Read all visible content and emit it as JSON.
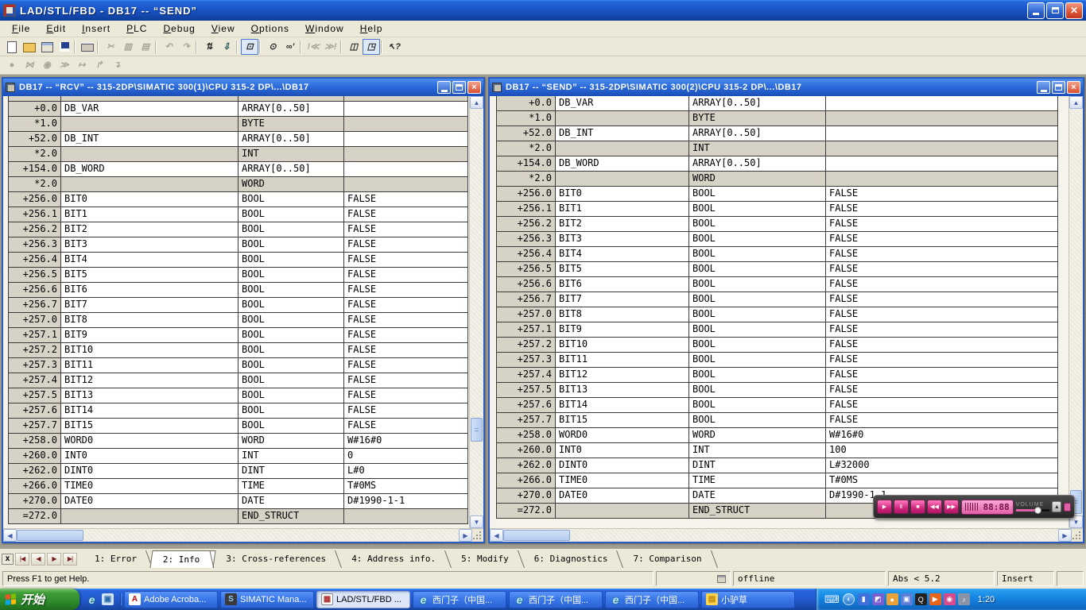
{
  "app": {
    "title": "LAD/STL/FBD  - DB17 -- “SEND”"
  },
  "menu": {
    "items": [
      {
        "label": "File"
      },
      {
        "label": "Edit"
      },
      {
        "label": "Insert"
      },
      {
        "label": "PLC"
      },
      {
        "label": "Debug"
      },
      {
        "label": "View"
      },
      {
        "label": "Options"
      },
      {
        "label": "Window"
      },
      {
        "label": "Help"
      }
    ]
  },
  "toolbar": {
    "row1": [
      {
        "name": "new-icon",
        "cls": "i-page"
      },
      {
        "name": "open-icon",
        "cls": "i-folder"
      },
      {
        "name": "station-icon",
        "cls": "i-station"
      },
      {
        "name": "save-icon",
        "cls": "i-floppy"
      },
      {
        "name": "toolbar-separator",
        "cls": "sep"
      },
      {
        "name": "print-icon",
        "cls": "i-printer"
      },
      {
        "name": "toolbar-separator",
        "cls": "sep"
      },
      {
        "name": "cut-icon",
        "glyph": "✂",
        "disabled": true
      },
      {
        "name": "copy-icon",
        "glyph": "▥",
        "disabled": true
      },
      {
        "name": "paste-icon",
        "glyph": "▤",
        "disabled": true
      },
      {
        "name": "toolbar-separator",
        "cls": "sep"
      },
      {
        "name": "undo-icon",
        "glyph": "↶",
        "disabled": true
      },
      {
        "name": "redo-icon",
        "glyph": "↷",
        "disabled": true
      },
      {
        "name": "toolbar-separator",
        "cls": "sep"
      },
      {
        "name": "call-structure-icon",
        "glyph": "⇅"
      },
      {
        "name": "download-icon",
        "glyph": "⇩",
        "cls": "dark"
      },
      {
        "name": "toolbar-separator",
        "cls": "sep"
      },
      {
        "name": "monitor-icon",
        "glyph": "⊡",
        "pressed": true
      },
      {
        "name": "toolbar-separator",
        "cls": "sep"
      },
      {
        "name": "address-icon",
        "glyph": "⊙"
      },
      {
        "name": "glasses-icon",
        "glyph": "∞'"
      },
      {
        "name": "toolbar-separator",
        "cls": "sep"
      },
      {
        "name": "prev-error-icon",
        "glyph": "!≪",
        "disabled": true
      },
      {
        "name": "next-error-icon",
        "glyph": "≫!",
        "disabled": true
      },
      {
        "name": "toolbar-separator",
        "cls": "sep"
      },
      {
        "name": "split-window-icon",
        "glyph": "◫"
      },
      {
        "name": "preview-icon",
        "glyph": "◳",
        "pressed": true
      },
      {
        "name": "toolbar-separator",
        "cls": "sep"
      },
      {
        "name": "context-help-icon",
        "glyph": "↖?"
      }
    ],
    "row2": [
      {
        "name": "new-network-icon",
        "glyph": "●",
        "disabled": true
      },
      {
        "name": "parallel-branch-icon",
        "glyph": "⋈",
        "disabled": true
      },
      {
        "name": "open-branch-icon",
        "glyph": "◉",
        "disabled": true
      },
      {
        "name": "close-branch-icon",
        "glyph": "≫",
        "disabled": true
      },
      {
        "name": "coil-icon",
        "glyph": "↦",
        "disabled": true
      },
      {
        "name": "jump-icon",
        "glyph": "↱",
        "disabled": true
      },
      {
        "name": "insert-row-icon",
        "glyph": "↴",
        "disabled": true
      }
    ]
  },
  "windows": {
    "left": {
      "title": "DB17 -- “RCV” -- 315-2DP\\SIMATIC 300(1)\\CPU 315-2 DP\\...\\DB17",
      "rows": [
        {
          "addr": "+0.0",
          "name": "DB_VAR",
          "type": "ARRAY[0..50]",
          "init": ""
        },
        {
          "addr": "*1.0",
          "name": "",
          "type": "BYTE",
          "init": "",
          "cls": "gray"
        },
        {
          "addr": "+52.0",
          "name": "DB_INT",
          "type": "ARRAY[0..50]",
          "init": ""
        },
        {
          "addr": "*2.0",
          "name": "",
          "type": "INT",
          "init": "",
          "cls": "gray"
        },
        {
          "addr": "+154.0",
          "name": "DB_WORD",
          "type": "ARRAY[0..50]",
          "init": ""
        },
        {
          "addr": "*2.0",
          "name": "",
          "type": "WORD",
          "init": "",
          "cls": "gray"
        },
        {
          "addr": "+256.0",
          "name": "BIT0",
          "type": "BOOL",
          "init": "FALSE"
        },
        {
          "addr": "+256.1",
          "name": "BIT1",
          "type": "BOOL",
          "init": "FALSE"
        },
        {
          "addr": "+256.2",
          "name": "BIT2",
          "type": "BOOL",
          "init": "FALSE"
        },
        {
          "addr": "+256.3",
          "name": "BIT3",
          "type": "BOOL",
          "init": "FALSE"
        },
        {
          "addr": "+256.4",
          "name": "BIT4",
          "type": "BOOL",
          "init": "FALSE"
        },
        {
          "addr": "+256.5",
          "name": "BIT5",
          "type": "BOOL",
          "init": "FALSE"
        },
        {
          "addr": "+256.6",
          "name": "BIT6",
          "type": "BOOL",
          "init": "FALSE"
        },
        {
          "addr": "+256.7",
          "name": "BIT7",
          "type": "BOOL",
          "init": "FALSE"
        },
        {
          "addr": "+257.0",
          "name": "BIT8",
          "type": "BOOL",
          "init": "FALSE"
        },
        {
          "addr": "+257.1",
          "name": "BIT9",
          "type": "BOOL",
          "init": "FALSE"
        },
        {
          "addr": "+257.2",
          "name": "BIT10",
          "type": "BOOL",
          "init": "FALSE"
        },
        {
          "addr": "+257.3",
          "name": "BIT11",
          "type": "BOOL",
          "init": "FALSE"
        },
        {
          "addr": "+257.4",
          "name": "BIT12",
          "type": "BOOL",
          "init": "FALSE"
        },
        {
          "addr": "+257.5",
          "name": "BIT13",
          "type": "BOOL",
          "init": "FALSE"
        },
        {
          "addr": "+257.6",
          "name": "BIT14",
          "type": "BOOL",
          "init": "FALSE"
        },
        {
          "addr": "+257.7",
          "name": "BIT15",
          "type": "BOOL",
          "init": "FALSE"
        },
        {
          "addr": "+258.0",
          "name": "WORD0",
          "type": "WORD",
          "init": "W#16#0"
        },
        {
          "addr": "+260.0",
          "name": "INT0",
          "type": "INT",
          "init": "0"
        },
        {
          "addr": "+262.0",
          "name": "DINT0",
          "type": "DINT",
          "init": "L#0"
        },
        {
          "addr": "+266.0",
          "name": "TIME0",
          "type": "TIME",
          "init": "T#0MS"
        },
        {
          "addr": "+270.0",
          "name": "DATE0",
          "type": "DATE",
          "init": "D#1990-1-1"
        },
        {
          "addr": "=272.0",
          "name": "",
          "type": "END_STRUCT",
          "init": "",
          "cls": "gray"
        }
      ]
    },
    "right": {
      "title": "DB17 -- “SEND” -- 315-2DP\\SIMATIC 300(2)\\CPU 315-2 DP\\...\\DB17",
      "rows": [
        {
          "addr": "+0.0",
          "name": "DB_VAR",
          "type": "ARRAY[0..50]",
          "init": ""
        },
        {
          "addr": "*1.0",
          "name": "",
          "type": "BYTE",
          "init": "",
          "cls": "gray"
        },
        {
          "addr": "+52.0",
          "name": "DB_INT",
          "type": "ARRAY[0..50]",
          "init": ""
        },
        {
          "addr": "*2.0",
          "name": "",
          "type": "INT",
          "init": "",
          "cls": "gray"
        },
        {
          "addr": "+154.0",
          "name": "DB_WORD",
          "type": "ARRAY[0..50]",
          "init": ""
        },
        {
          "addr": "*2.0",
          "name": "",
          "type": "WORD",
          "init": "",
          "cls": "gray"
        },
        {
          "addr": "+256.0",
          "name": "BIT0",
          "type": "BOOL",
          "init": "FALSE"
        },
        {
          "addr": "+256.1",
          "name": "BIT1",
          "type": "BOOL",
          "init": "FALSE"
        },
        {
          "addr": "+256.2",
          "name": "BIT2",
          "type": "BOOL",
          "init": "FALSE"
        },
        {
          "addr": "+256.3",
          "name": "BIT3",
          "type": "BOOL",
          "init": "FALSE"
        },
        {
          "addr": "+256.4",
          "name": "BIT4",
          "type": "BOOL",
          "init": "FALSE"
        },
        {
          "addr": "+256.5",
          "name": "BIT5",
          "type": "BOOL",
          "init": "FALSE"
        },
        {
          "addr": "+256.6",
          "name": "BIT6",
          "type": "BOOL",
          "init": "FALSE"
        },
        {
          "addr": "+256.7",
          "name": "BIT7",
          "type": "BOOL",
          "init": "FALSE"
        },
        {
          "addr": "+257.0",
          "name": "BIT8",
          "type": "BOOL",
          "init": "FALSE"
        },
        {
          "addr": "+257.1",
          "name": "BIT9",
          "type": "BOOL",
          "init": "FALSE"
        },
        {
          "addr": "+257.2",
          "name": "BIT10",
          "type": "BOOL",
          "init": "FALSE"
        },
        {
          "addr": "+257.3",
          "name": "BIT11",
          "type": "BOOL",
          "init": "FALSE"
        },
        {
          "addr": "+257.4",
          "name": "BIT12",
          "type": "BOOL",
          "init": "FALSE"
        },
        {
          "addr": "+257.5",
          "name": "BIT13",
          "type": "BOOL",
          "init": "FALSE"
        },
        {
          "addr": "+257.6",
          "name": "BIT14",
          "type": "BOOL",
          "init": "FALSE"
        },
        {
          "addr": "+257.7",
          "name": "BIT15",
          "type": "BOOL",
          "init": "FALSE"
        },
        {
          "addr": "+258.0",
          "name": "WORD0",
          "type": "WORD",
          "init": "W#16#0"
        },
        {
          "addr": "+260.0",
          "name": "INT0",
          "type": "INT",
          "init": "100"
        },
        {
          "addr": "+262.0",
          "name": "DINT0",
          "type": "DINT",
          "init": "L#32000"
        },
        {
          "addr": "+266.0",
          "name": "TIME0",
          "type": "TIME",
          "init": "T#0MS"
        },
        {
          "addr": "+270.0",
          "name": "DATE0",
          "type": "DATE",
          "init": "D#1990-1-1"
        },
        {
          "addr": "=272.0",
          "name": "",
          "type": "END_STRUCT",
          "init": "",
          "cls": "gray"
        }
      ]
    }
  },
  "tabs": {
    "items": [
      {
        "label": "1: Error"
      },
      {
        "label": "2: Info",
        "active": true
      },
      {
        "label": "3: Cross-references"
      },
      {
        "label": "4: Address info."
      },
      {
        "label": "5: Modify"
      },
      {
        "label": "6: Diagnostics"
      },
      {
        "label": "7: Comparison"
      }
    ]
  },
  "statusbar": {
    "help": "Press F1 to get Help.",
    "mode": "offline",
    "abs": "Abs < 5.2",
    "insert": "Insert"
  },
  "player": {
    "volume_label": "VOLUME",
    "time": "88:88",
    "buttons": [
      {
        "name": "play-button",
        "glyph": "▶"
      },
      {
        "name": "pause-button",
        "glyph": "Ⅱ"
      },
      {
        "name": "stop-button",
        "glyph": "■"
      },
      {
        "name": "prev-button",
        "glyph": "◀◀"
      },
      {
        "name": "next-button",
        "glyph": "▶▶"
      }
    ]
  },
  "taskbar": {
    "start_label": "开始",
    "quick": [
      {
        "name": "quicklaunch-ie",
        "icon": "ie"
      },
      {
        "name": "quicklaunch-desktop",
        "icon": "desk"
      }
    ],
    "buttons": [
      {
        "icon": "adobe",
        "label": "Adobe Acroba..."
      },
      {
        "icon": "simatic",
        "label": "SIMATIC Mana..."
      },
      {
        "icon": "lad",
        "label": "LAD/STL/FBD ...",
        "active": true
      },
      {
        "icon": "ie",
        "label": "西门子（中国..."
      },
      {
        "icon": "ie",
        "label": "西门子（中国..."
      },
      {
        "icon": "ie",
        "label": "西门子（中国..."
      },
      {
        "icon": "note",
        "label": "小驴草"
      }
    ],
    "tray": {
      "keyboard": "⌨",
      "chevron": "‹",
      "icons": [
        {
          "name": "battery-icon",
          "glyph": "▮",
          "color": "#3f6fd8"
        },
        {
          "name": "device-icon",
          "glyph": "◩",
          "color": "#7a5fd0"
        },
        {
          "name": "pplive-icon",
          "glyph": "●",
          "color": "#e8a23a"
        },
        {
          "name": "display-icon",
          "glyph": "▣",
          "color": "#5a7fd8"
        },
        {
          "name": "qq-icon",
          "glyph": "Q",
          "color": "#222222"
        },
        {
          "name": "media-play-icon",
          "glyph": "▶",
          "color": "#e8641a"
        },
        {
          "name": "camera-icon",
          "glyph": "◉",
          "color": "#d84a8a"
        },
        {
          "name": "volume-icon",
          "glyph": "♪",
          "color": "#8a94a8"
        }
      ],
      "clock": "1:20"
    }
  },
  "colors": {
    "titlebar_blue": "#1a55c8",
    "table_gray": "#d6d2c6",
    "player_pink": "#d1267e",
    "taskbar_blue": "#2158cd",
    "start_green": "#2f8b2c"
  }
}
